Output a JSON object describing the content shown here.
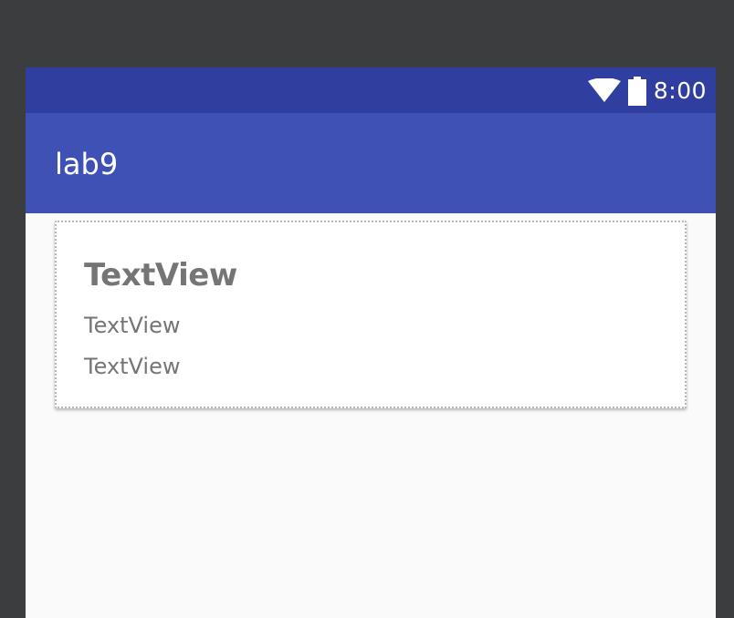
{
  "status_bar": {
    "time": "8:00",
    "icons": [
      "wifi-icon",
      "battery-icon"
    ],
    "color": "#303f9f"
  },
  "app_bar": {
    "title": "lab9",
    "color": "#3f51b5"
  },
  "card": {
    "title": "TextView",
    "lines": [
      "TextView",
      "TextView"
    ]
  }
}
